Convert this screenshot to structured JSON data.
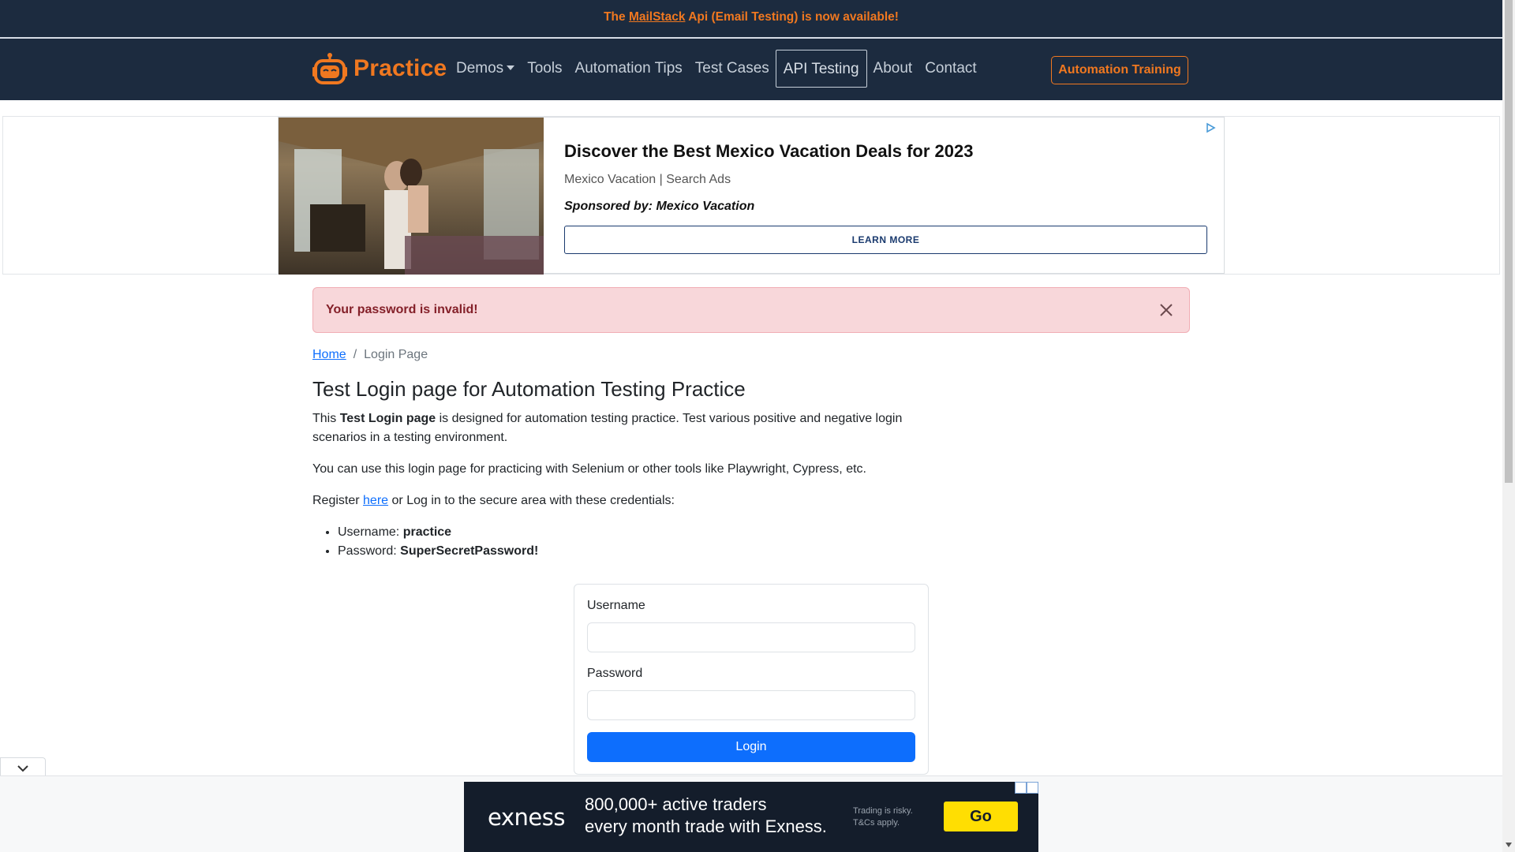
{
  "announcement": {
    "prefix": "The",
    "link": "MailStack",
    "suffix": "Api (Email Testing) is now available!"
  },
  "navbar": {
    "brand": "Practice",
    "items": [
      {
        "label": "Demos",
        "dropdown": true
      },
      {
        "label": "Tools"
      },
      {
        "label": "Automation Tips"
      },
      {
        "label": "Test Cases"
      },
      {
        "label": "API Testing",
        "active": true
      },
      {
        "label": "About"
      },
      {
        "label": "Contact"
      }
    ],
    "cta": "Automation Training"
  },
  "ad_banner": {
    "title": "Discover the Best Mexico Vacation Deals for 2023",
    "subtitle": "Mexico Vacation | Search Ads",
    "sponsor": "Sponsored by: Mexico Vacation",
    "button": "LEARN MORE"
  },
  "alert": {
    "message": "Your password is invalid!"
  },
  "breadcrumb": {
    "home": "Home",
    "separator": "/",
    "current": "Login Page"
  },
  "content": {
    "heading": "Test Login page for Automation Testing Practice",
    "p1_prefix": "This",
    "p1_bold": "Test Login page",
    "p1_suffix": "is designed for automation testing practice. Test various positive and negative login scenarios in a testing environment.",
    "p2": "You can use this login page for practicing with Selenium or other tools like Playwright, Cypress, etc.",
    "p3_prefix": "Register",
    "p3_link": "here",
    "p3_suffix": "or Log in to the secure area with these credentials:",
    "cred_username_label": "Username:",
    "cred_username": "practice",
    "cred_password_label": "Password:",
    "cred_password": "SuperSecretPassword!"
  },
  "form": {
    "username_label": "Username",
    "username_value": "",
    "password_label": "Password",
    "password_value": "",
    "submit": "Login"
  },
  "sticky_ad": {
    "brand": "exness",
    "line1": "800,000+ active traders",
    "line2": "every month trade with Exness.",
    "risk1": "Trading is risky.",
    "risk2": "T&Cs apply.",
    "button": "Go"
  },
  "colors": {
    "navbar_bg": "#1c2b3f",
    "brand_orange": "#f07820",
    "alert_bg": "#f8d7da",
    "alert_text": "#842029",
    "primary": "#0d6efd",
    "go_yellow": "#ffde02"
  }
}
